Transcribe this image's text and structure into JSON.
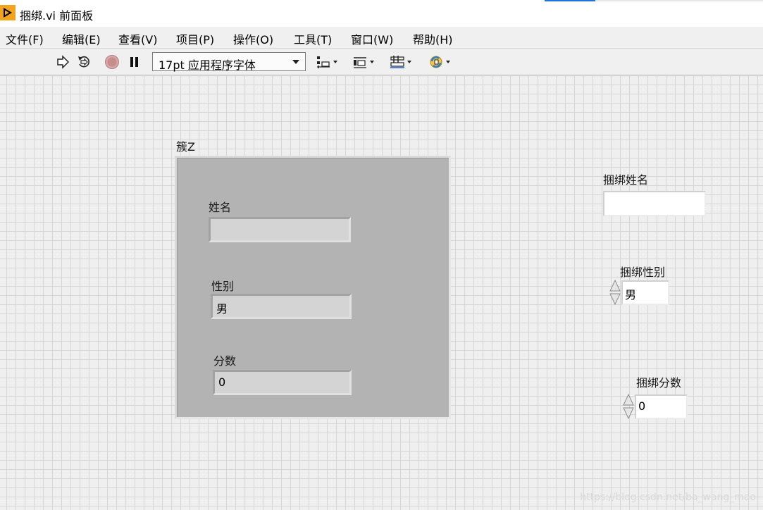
{
  "window": {
    "title": "捆绑.vi 前面板"
  },
  "menu": [
    {
      "label": "文件(F)"
    },
    {
      "label": "编辑(E)"
    },
    {
      "label": "查看(V)"
    },
    {
      "label": "项目(P)"
    },
    {
      "label": "操作(O)"
    },
    {
      "label": "工具(T)"
    },
    {
      "label": "窗口(W)"
    },
    {
      "label": "帮助(H)"
    }
  ],
  "toolbar": {
    "icons": [
      "run-arrow-icon",
      "run-continuously-icon",
      "abort-stop-icon",
      "pause-icon",
      "align-objects-icon",
      "distribute-objects-icon",
      "resize-objects-icon",
      "reorder-icon"
    ],
    "font_select": "17pt 应用程序字体"
  },
  "panel": {
    "cluster": {
      "label": "簇Z",
      "name_label": "姓名",
      "name_value": "",
      "gender_label": "性别",
      "gender_value": "男",
      "score_label": "分数",
      "score_value": "0"
    },
    "bundle_name": {
      "label": "捆绑姓名",
      "value": ""
    },
    "bundle_gender": {
      "label": "捆绑性别",
      "value": "男"
    },
    "bundle_score": {
      "label": "捆绑分数",
      "value": "0"
    }
  },
  "watermark": "https://blog.csdn.net/ba_wang_mao",
  "colors": {
    "grid_background": "#efefef",
    "grid_lines": "#d6d6d6",
    "cluster_fill": "#b3b3b3",
    "indicator_fill": "#d4d4d4",
    "control_fill": "#ffffff",
    "title_accent": "#1e73d6",
    "labview_icon": "#f2a51a"
  }
}
